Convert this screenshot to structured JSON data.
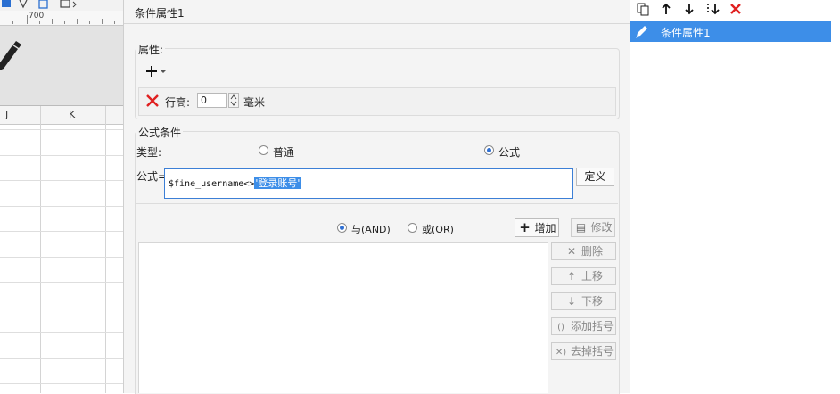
{
  "left": {
    "ruler_label": "700",
    "columns": [
      "J",
      "K"
    ]
  },
  "dialog": {
    "title": "条件属性1",
    "properties": {
      "group_label": "属性:",
      "add_icon": "plus-dropdown-icon",
      "row_height_label": "行高:",
      "row_height_value": "0",
      "unit": "毫米",
      "delete_icon": "red-x-icon"
    },
    "formula_condition": {
      "group_label": "公式条件",
      "type_label": "类型:",
      "type_options": [
        "普通",
        "公式"
      ],
      "type_selected": "公式",
      "formula_label": "公式=",
      "formula_prefix": "$fine_username<>",
      "formula_selected": "'登录账号'",
      "define_button": "定义",
      "logic_options": [
        "与(AND)",
        "或(OR)"
      ],
      "logic_selected": "与(AND)",
      "add_button": "增加",
      "edit_button": "修改",
      "side_buttons": [
        "删除",
        "上移",
        "下移",
        "添加括号",
        "去掉括号"
      ]
    }
  },
  "right": {
    "toolbar_icons": [
      "copy-icon",
      "move-up-icon",
      "move-down-icon",
      "move-bottom-icon",
      "delete-icon"
    ],
    "items": [
      {
        "label": "条件属性1",
        "selected": true
      }
    ]
  },
  "colors": {
    "selection": "#3d8ee8",
    "delete_red": "#e02020"
  }
}
